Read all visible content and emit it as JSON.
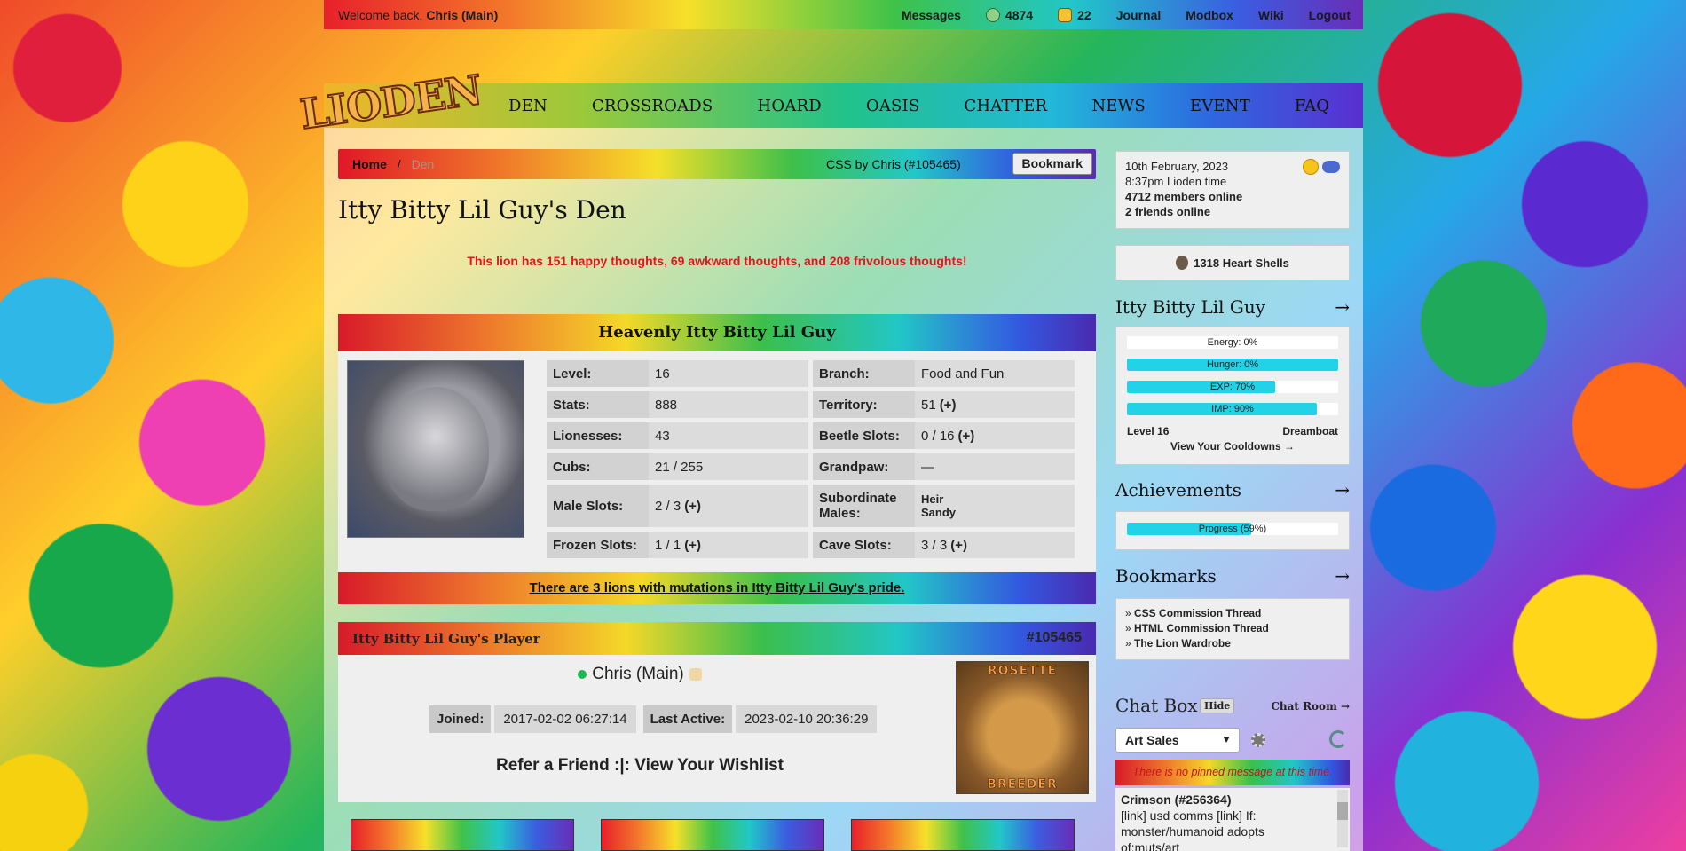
{
  "topbar": {
    "welcome_prefix": "Welcome back,",
    "user": "Chris (Main)",
    "messages": "Messages",
    "count1": "4874",
    "count2": "22",
    "journal": "Journal",
    "modbox": "Modbox",
    "wiki": "Wiki",
    "logout": "Logout"
  },
  "logo": "LIODEN",
  "nav": [
    "DEN",
    "CROSSROADS",
    "HOARD",
    "OASIS",
    "CHATTER",
    "NEWS",
    "EVENT",
    "FAQ"
  ],
  "breadcrumb": {
    "home": "Home",
    "sep": "/",
    "current": "Den",
    "css_credit": "CSS by Chris (#105465)",
    "bookmark": "Bookmark"
  },
  "den": {
    "title": "Itty Bitty Lil Guy's Den",
    "thoughts": "This lion has 151 happy thoughts, 69 awkward thoughts, and 208 frivolous thoughts!"
  },
  "lion": {
    "header": "Heavenly Itty Bitty Lil Guy",
    "stats": [
      {
        "k": "Level:",
        "v": "16",
        "k2": "Branch:",
        "v2": "Food and Fun"
      },
      {
        "k": "Stats:",
        "v": "888",
        "k2": "Territory:",
        "v2": "51",
        "plus2": "(+)"
      },
      {
        "k": "Lionesses:",
        "v": "43",
        "k2": "Beetle Slots:",
        "v2": "0 / 16",
        "plus2": "(+)"
      },
      {
        "k": "Cubs:",
        "v": "21 / 255",
        "k2": "Grandpaw:",
        "v2": "—"
      },
      {
        "k": "Male Slots:",
        "v": "2 / 3",
        "plus": "(+)",
        "k2": "Subordinate Males:",
        "v2a": "Heir",
        "v2b": "Sandy"
      },
      {
        "k": "Frozen Slots:",
        "v": "1 / 1",
        "plus": "(+)",
        "k2": "Cave Slots:",
        "v2": "3 / 3",
        "plus2": "(+)"
      }
    ],
    "mutations": "There are 3 lions with mutations in Itty Bitty Lil Guy's pride."
  },
  "player": {
    "header": "Itty Bitty Lil Guy's Player",
    "id": "#105465",
    "name": "Chris (Main)",
    "joined_label": "Joined:",
    "joined": "2017-02-02 06:27:14",
    "active_label": "Last Active:",
    "active": "2023-02-10 20:36:29",
    "refer": "Refer a Friend :|: View Your Wishlist",
    "avatar_top": "ROSETTE",
    "avatar_bottom": "BREEDER"
  },
  "sidebar": {
    "date": "10th February, 2023",
    "time": "8:37pm Lioden time",
    "members": "4712 members online",
    "friends": "2 friends online",
    "hearts": "1318 Heart Shells",
    "guy_title": "Itty Bitty Lil Guy",
    "arrow": "→",
    "bars": [
      {
        "label": "Energy: 0%",
        "pct": 0
      },
      {
        "label": "Hunger: 0%",
        "pct": 100
      },
      {
        "label": "EXP: 70%",
        "pct": 70
      },
      {
        "label": "IMP: 90%",
        "pct": 90
      }
    ],
    "level": "Level 16",
    "rank": "Dreamboat",
    "cooldowns": "View Your Cooldowns →",
    "ach_title": "Achievements",
    "ach_bar": {
      "label": "Progress (59%)",
      "pct": 59
    },
    "bm_title": "Bookmarks",
    "bookmarks": [
      "CSS Commission Thread",
      "HTML Commission Thread",
      "The Lion Wardrobe"
    ],
    "chat_title": "Chat Box",
    "hide": "Hide",
    "chat_room": "Chat Room →",
    "chat_select": "Art Sales",
    "pinned": "There is no pinned message at this time.",
    "chat_user": "Crimson (#256364)",
    "chat_msg_a": "[link] usd comms [link] If:",
    "chat_msg_b": "monster/humanoid adopts",
    "chat_msg_c": "of:muts/art"
  },
  "colors": {
    "accent": "#22d2e6",
    "alert": "#e0161e"
  }
}
